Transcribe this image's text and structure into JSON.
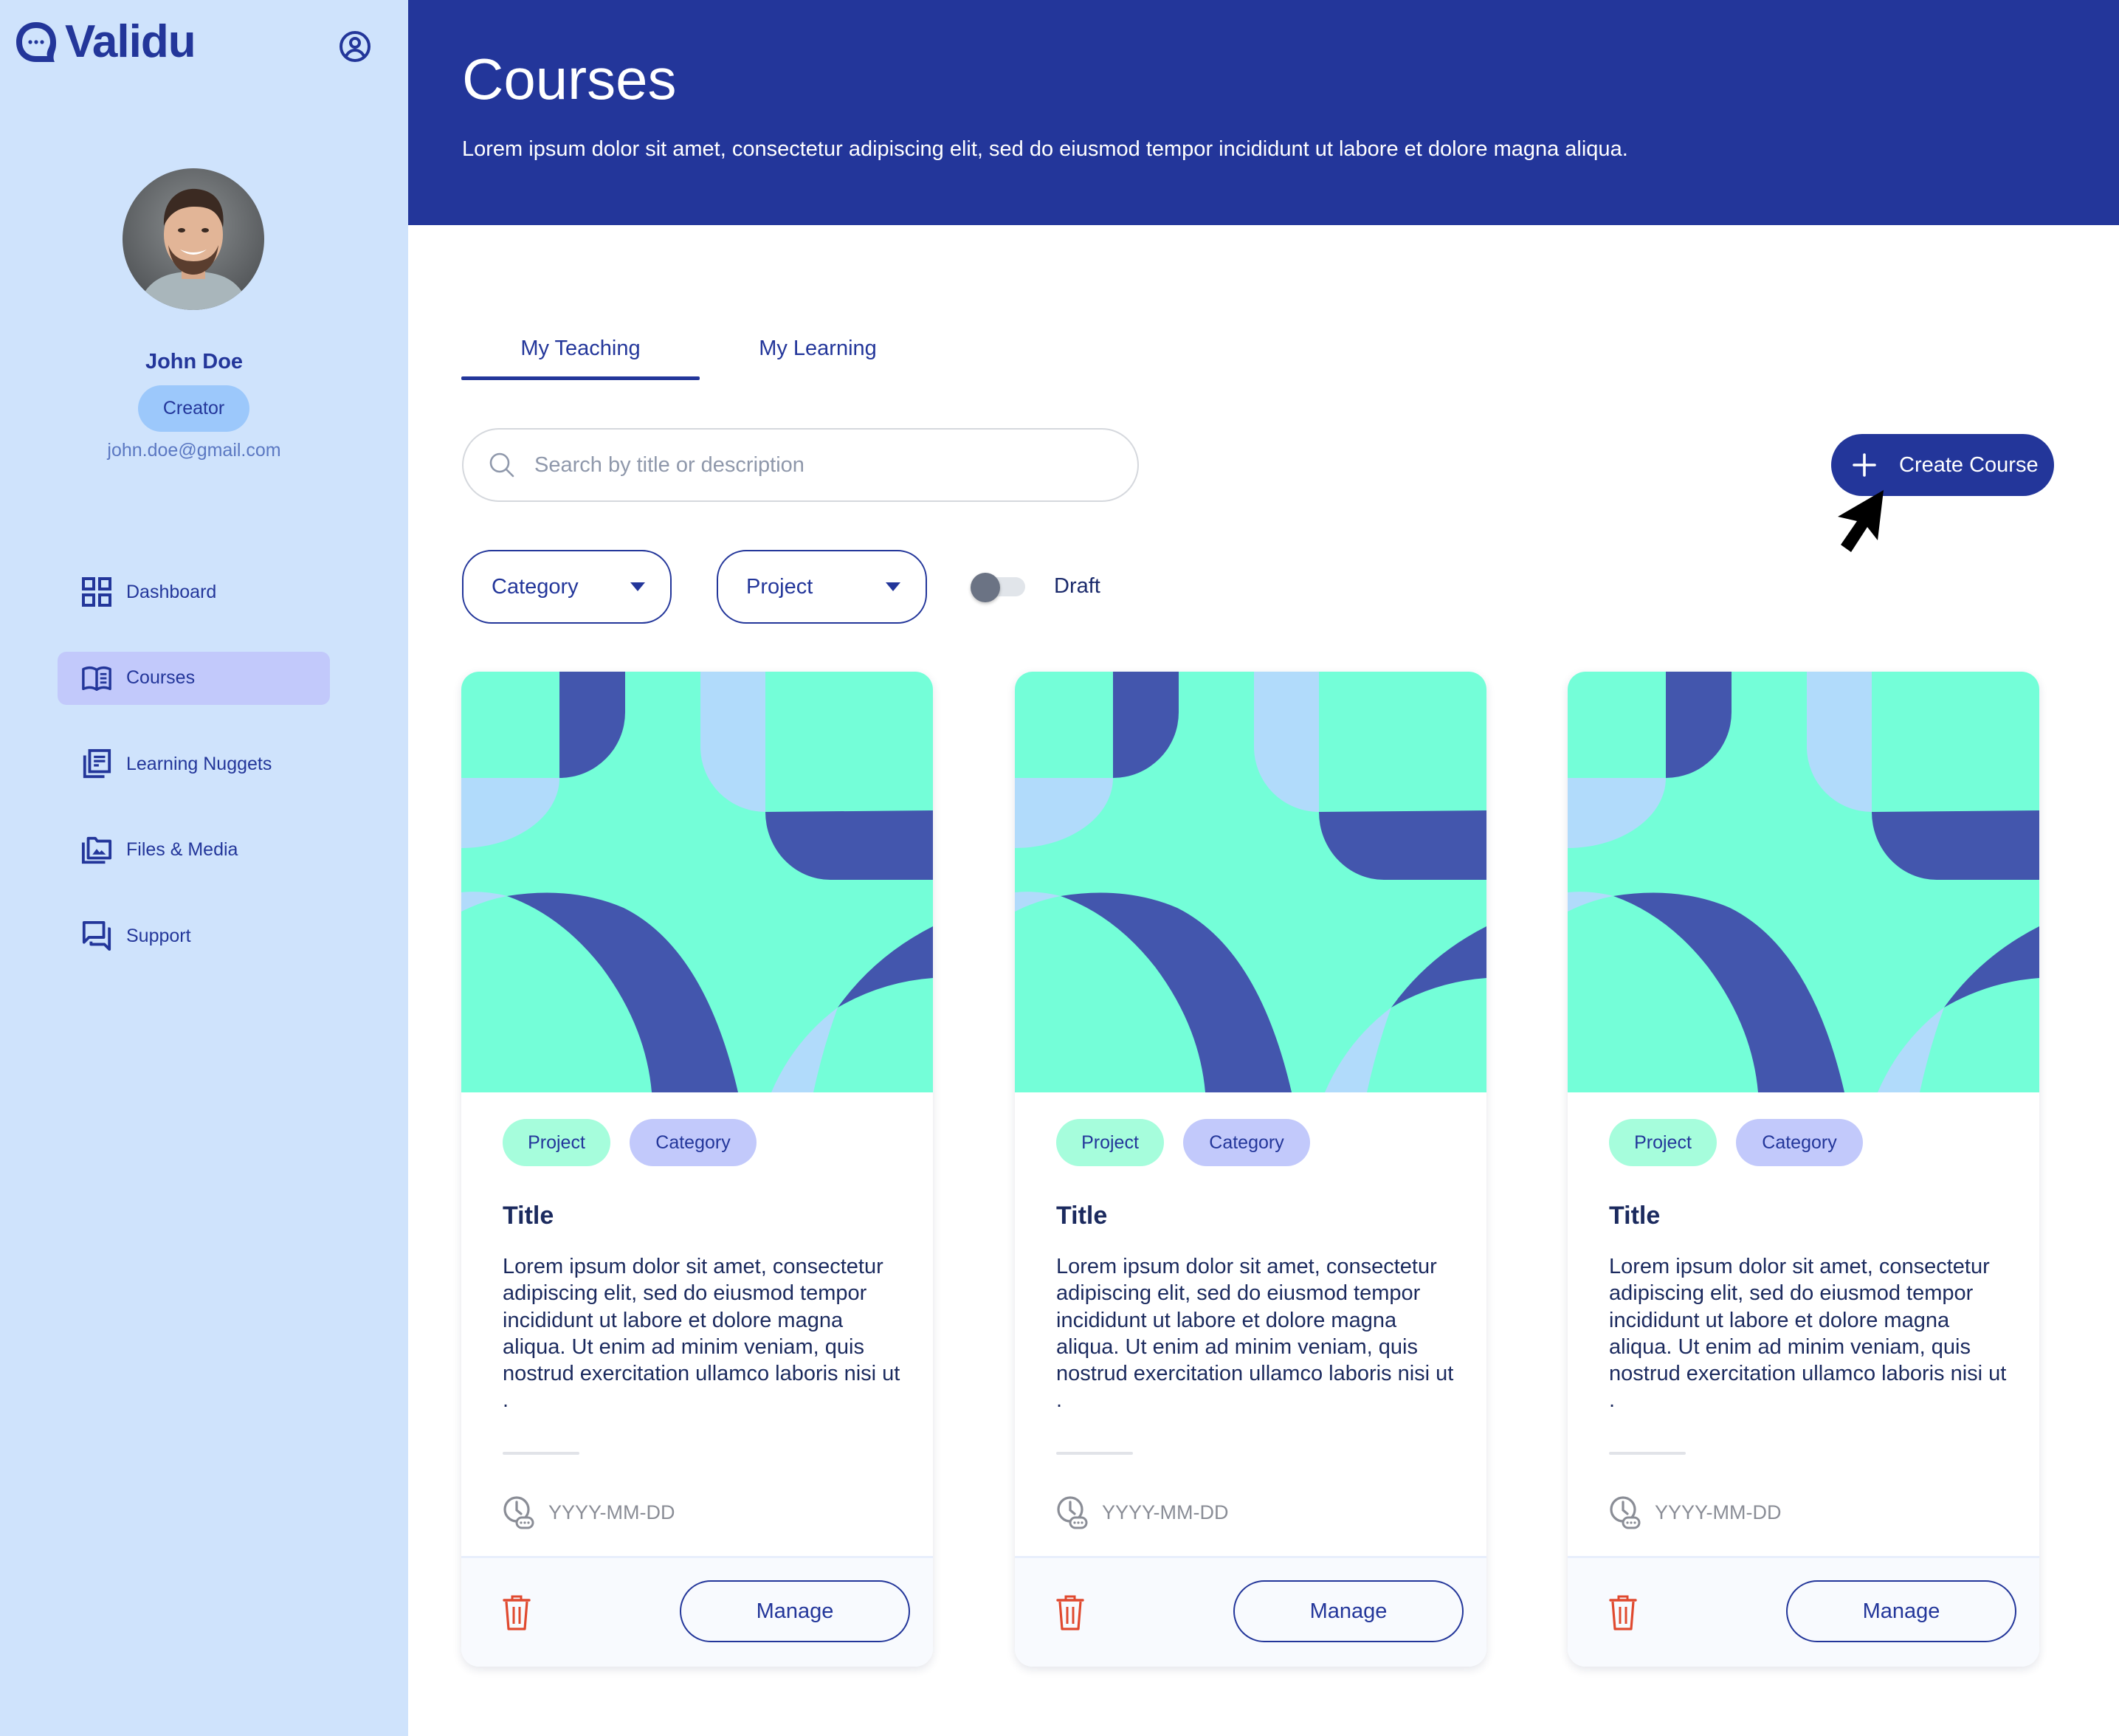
{
  "app": {
    "name": "Validu",
    "colors": {
      "brand": "#23369a",
      "sidebar_bg": "#cfe3fc",
      "active_nav": "#c2c9fb",
      "project_tag": "#a6fddc",
      "category_tag": "#c2c9fb",
      "delete": "#e0492f",
      "card_art_bg": "#74fed8",
      "card_art_dark": "#4356ad",
      "card_art_light": "#b1dbfb"
    }
  },
  "sidebar": {
    "profile_icon": "user-circle-icon",
    "user": {
      "name": "John Doe",
      "role": "Creator",
      "email": "john.doe@gmail.com"
    },
    "nav": [
      {
        "label": "Dashboard",
        "icon": "grid-icon",
        "active": false
      },
      {
        "label": "Courses",
        "icon": "open-book-icon",
        "active": true
      },
      {
        "label": "Learning Nuggets",
        "icon": "document-stack-icon",
        "active": false
      },
      {
        "label": "Files & Media",
        "icon": "image-folder-icon",
        "active": false
      },
      {
        "label": "Support",
        "icon": "chat-bubbles-icon",
        "active": false
      }
    ]
  },
  "header": {
    "title": "Courses",
    "subtitle": "Lorem ipsum dolor sit amet, consectetur adipiscing elit, sed do eiusmod tempor incididunt ut labore et dolore magna aliqua."
  },
  "tabs": [
    {
      "label": "My Teaching",
      "active": true
    },
    {
      "label": "My Learning",
      "active": false
    }
  ],
  "search": {
    "value": "",
    "placeholder": "Search by title or description"
  },
  "create_button": {
    "label": "Create Course",
    "icon": "plus-icon"
  },
  "filters": {
    "category": {
      "label": "Category"
    },
    "project": {
      "label": "Project"
    },
    "draft": {
      "label": "Draft",
      "on": false
    }
  },
  "cards": [
    {
      "project_tag": "Project",
      "category_tag": "Category",
      "title": "Title",
      "description": "Lorem ipsum dolor sit amet, consectetur adipiscing elit, sed do eiusmod tempor incididunt ut labore et dolore magna aliqua. Ut enim ad minim veniam, quis nostrud exercitation ullamco laboris nisi ut .",
      "date": "YYYY-MM-DD",
      "manage_label": "Manage"
    },
    {
      "project_tag": "Project",
      "category_tag": "Category",
      "title": "Title",
      "description": "Lorem ipsum dolor sit amet, consectetur adipiscing elit, sed do eiusmod tempor incididunt ut labore et dolore magna aliqua. Ut enim ad minim veniam, quis nostrud exercitation ullamco laboris nisi ut .",
      "date": "YYYY-MM-DD",
      "manage_label": "Manage"
    },
    {
      "project_tag": "Project",
      "category_tag": "Category",
      "title": "Title",
      "description": "Lorem ipsum dolor sit amet, consectetur adipiscing elit, sed do eiusmod tempor incididunt ut labore et dolore magna aliqua. Ut enim ad minim veniam, quis nostrud exercitation ullamco laboris nisi ut .",
      "date": "YYYY-MM-DD",
      "manage_label": "Manage"
    }
  ]
}
